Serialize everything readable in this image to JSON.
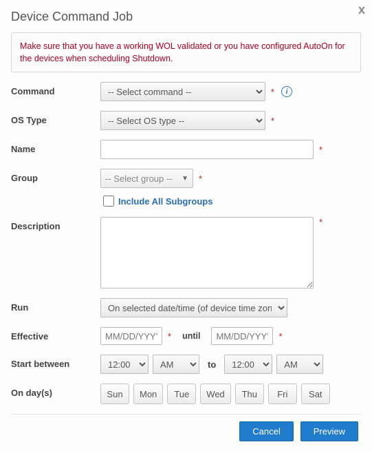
{
  "dialog": {
    "title": "Device Command Job",
    "close_label": "x",
    "warning": "Make sure that you have a working WOL validated or you have configured AutoOn for the devices when scheduling Shutdown."
  },
  "labels": {
    "command": "Command",
    "os_type": "OS Type",
    "name": "Name",
    "group": "Group",
    "include_subgroups": "Include All Subgroups",
    "description": "Description",
    "run": "Run",
    "effective": "Effective",
    "until": "until",
    "start_between": "Start between",
    "to": "to",
    "on_days": "On day(s)"
  },
  "fields": {
    "command_placeholder": "-- Select command --",
    "os_type_placeholder": "-- Select OS type --",
    "name_value": "",
    "group_placeholder": "-- Select group --",
    "include_subgroups_checked": false,
    "description_value": "",
    "run_value": "On selected date/time (of device time zone)",
    "effective_from_placeholder": "MM/DD/YYYY",
    "effective_until_placeholder": "MM/DD/YYYY",
    "start_time1": "12:00",
    "start_ampm1": "AM",
    "start_time2": "12:00",
    "start_ampm2": "AM"
  },
  "days": [
    "Sun",
    "Mon",
    "Tue",
    "Wed",
    "Thu",
    "Fri",
    "Sat"
  ],
  "footer": {
    "cancel": "Cancel",
    "preview": "Preview"
  },
  "required_marker": "*",
  "info_glyph": "i"
}
